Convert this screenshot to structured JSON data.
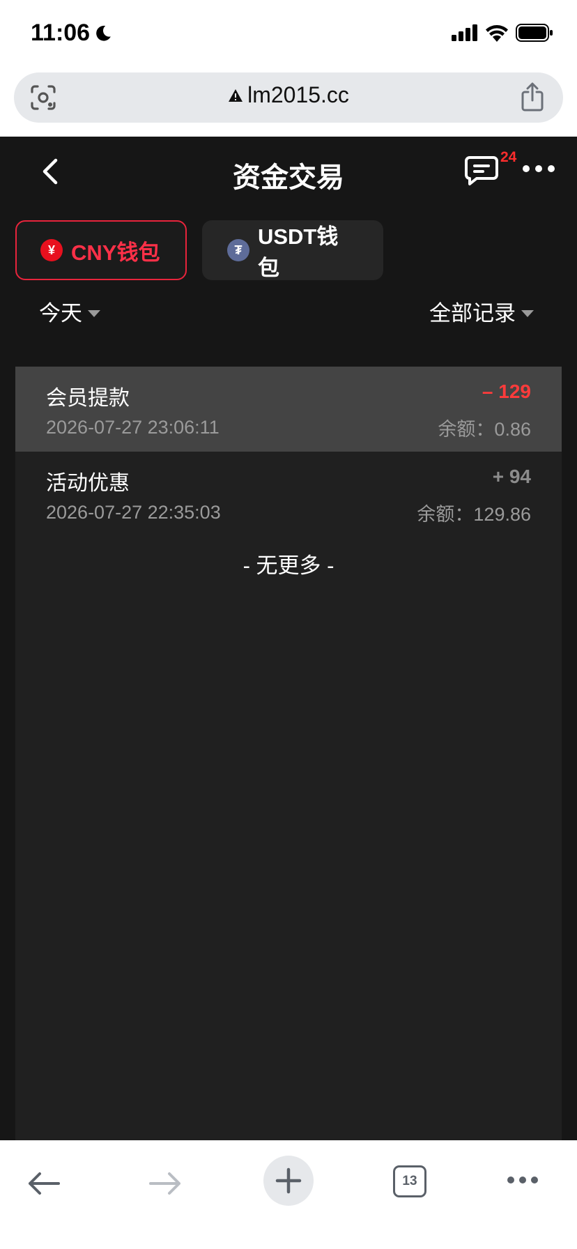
{
  "status_bar": {
    "time": "11:06",
    "icons": [
      "moon-icon",
      "signal-icon",
      "wifi-icon",
      "battery-icon"
    ]
  },
  "browser": {
    "url": "lm2015.cc",
    "tab_count": "13"
  },
  "header": {
    "title": "资金交易",
    "message_badge": "24"
  },
  "tabs": [
    {
      "label": "CNY钱包",
      "active": true,
      "coin_symbol": "¥"
    },
    {
      "label": "USDT钱包",
      "active": false,
      "coin_symbol": "₮"
    }
  ],
  "filters": {
    "date": "今天",
    "type": "全部记录"
  },
  "transactions": [
    {
      "type": "会员提款",
      "time": "2026-07-27 23:06:11",
      "amount": "– 129",
      "balance": "余额：0.86"
    },
    {
      "type": "活动优惠",
      "time": "2026-07-27 22:35:03",
      "amount": "+ 94",
      "balance": "余额：129.86"
    }
  ],
  "footer_text": "- 无更多 -",
  "colors": {
    "accent": "#e8243c",
    "negative": "#ff3b3b",
    "badge": "#ff2d2d",
    "background": "#161616"
  }
}
